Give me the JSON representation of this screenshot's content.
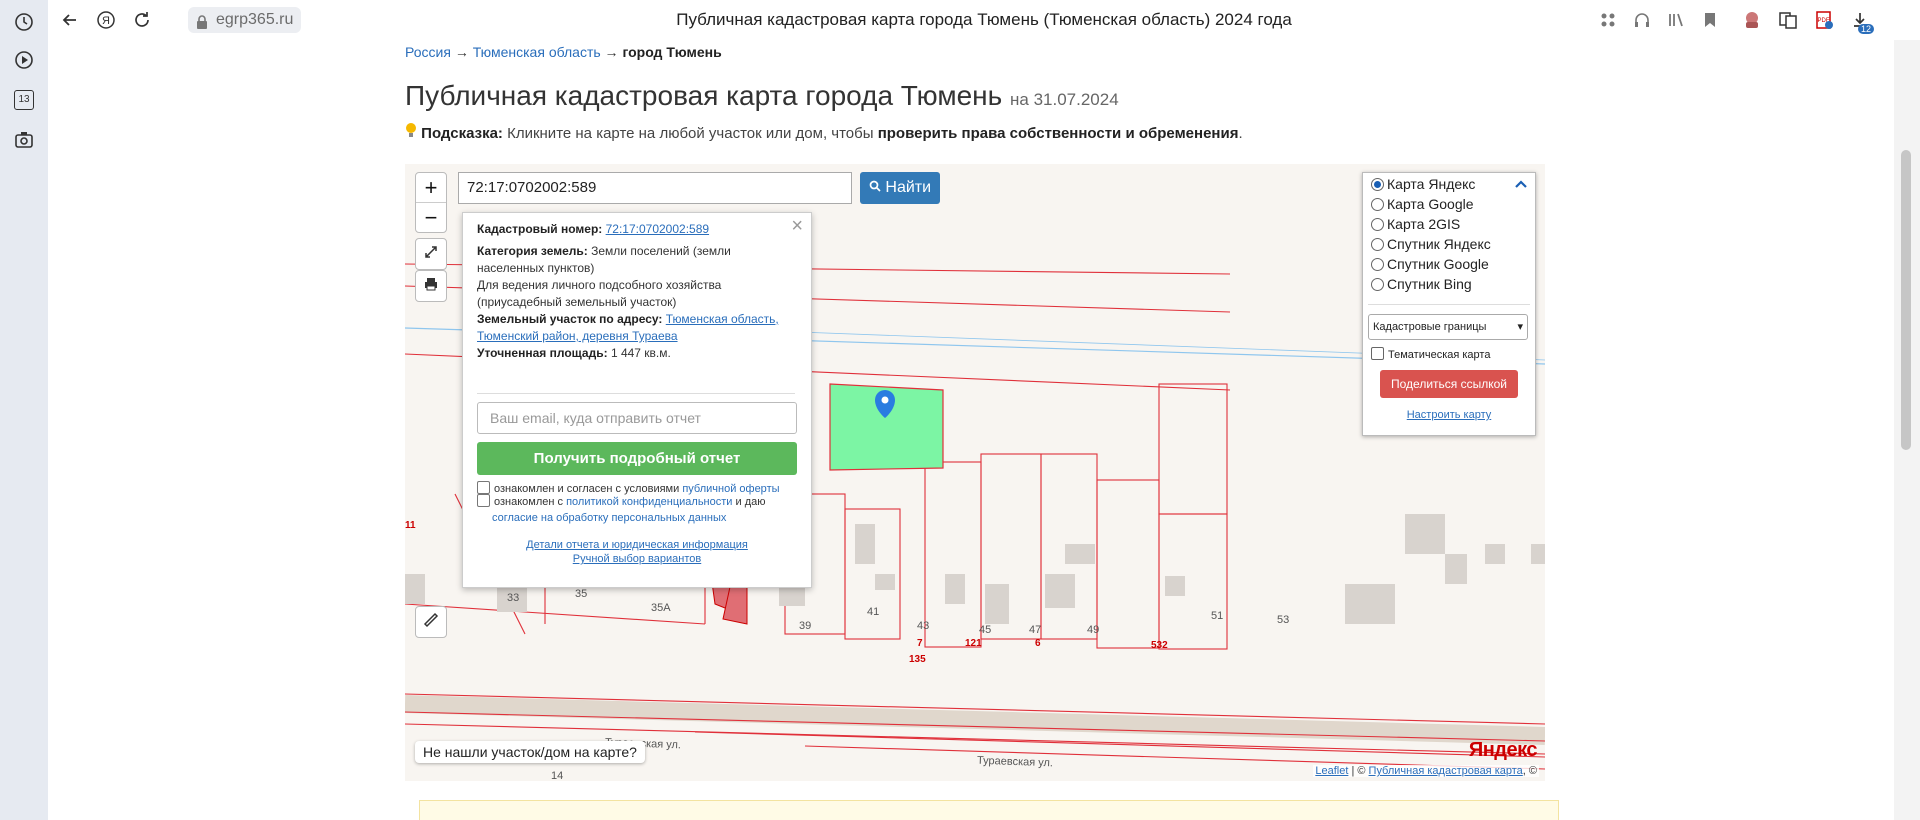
{
  "rail": {
    "icons": [
      "clock-icon",
      "play-circle-icon",
      "calendar-icon",
      "camera-icon"
    ],
    "calendar_label": "13"
  },
  "browser": {
    "url": "egrp365.ru",
    "tab_title": "Публичная кадастровая карта города Тюмень (Тюменская область) 2024 года",
    "download_badge": "12"
  },
  "breadcrumbs": {
    "item1": "Россия",
    "sep": "→",
    "item2": "Тюменская область",
    "current": "город Тюмень"
  },
  "page": {
    "title": "Публичная кадастровая карта города Тюмень",
    "date": "на 31.07.2024",
    "hint_label": "Подсказка:",
    "hint_text": "Кликните на карте на любой участок или дом, чтобы",
    "hint_bold": "проверить права собственности и обременения",
    "hint_end": "."
  },
  "map": {
    "zoom_in": "+",
    "zoom_out": "−",
    "search_value": "72:17:0702002:589",
    "find_label": "Найти",
    "not_found": "Не нашли участок/дом на карте?",
    "attribution_leaflet": "Leaflet",
    "attribution_sep": "| ©",
    "attribution_pkk": "Публичная кадастровая карта",
    "attribution_end": ", ©",
    "yandex_logo": "Яндекс",
    "labels": [
      "33",
      "35",
      "35А",
      "39",
      "41",
      "43",
      "45",
      "47",
      "49",
      "51",
      "53",
      "7",
      "121",
      "6",
      "532",
      "135",
      "11",
      "14"
    ],
    "streets": [
      "Тураевская ул.",
      "Тураевская ул."
    ]
  },
  "popup": {
    "cad_label": "Кадастровый номер:",
    "cad_value": "72:17:0702002:589",
    "cat_label": "Категория земель:",
    "cat_value": "Земли поселений (земли населенных пунктов)",
    "use_value": "Для ведения личного подсобного хозяйства (приусадебный земельный участок)",
    "addr_label": "Земельный участок по адресу:",
    "addr_value": "Тюменская область, Тюменский район, деревня Тураева",
    "area_label": "Уточненная площадь:",
    "area_value": "1 447 кв.м.",
    "email_placeholder": "Ваш email, куда отправить отчет",
    "get_report": "Получить подробный отчет",
    "agree1_text": "ознакомлен и согласен с условиями",
    "agree1_link": "публичной оферты",
    "agree2_text": "ознакомлен с",
    "agree2_link": "политикой конфиденциальности",
    "agree2_mid": "и даю",
    "agree2_link2": "согласие на обработку персональных данных",
    "details_link": "Детали отчета и юридическая информация",
    "manual_link": "Ручной выбор вариантов"
  },
  "layers": {
    "options": [
      "Карта Яндекс",
      "Карта Google",
      "Карта 2GIS",
      "Спутник Яндекс",
      "Спутник Google",
      "Спутник Bing"
    ],
    "selected": "Карта Яндекс",
    "overlay_select": "Кадастровые границы",
    "thematic": "Тематическая карта",
    "share": "Поделиться ссылкой",
    "configure": "Настроить карту"
  },
  "colors": {
    "accent": "#337ab7",
    "success": "#5cb85c",
    "danger": "#d9534f",
    "parcel_selected": "#7cf5a4",
    "parcel_line": "#e0303a"
  }
}
